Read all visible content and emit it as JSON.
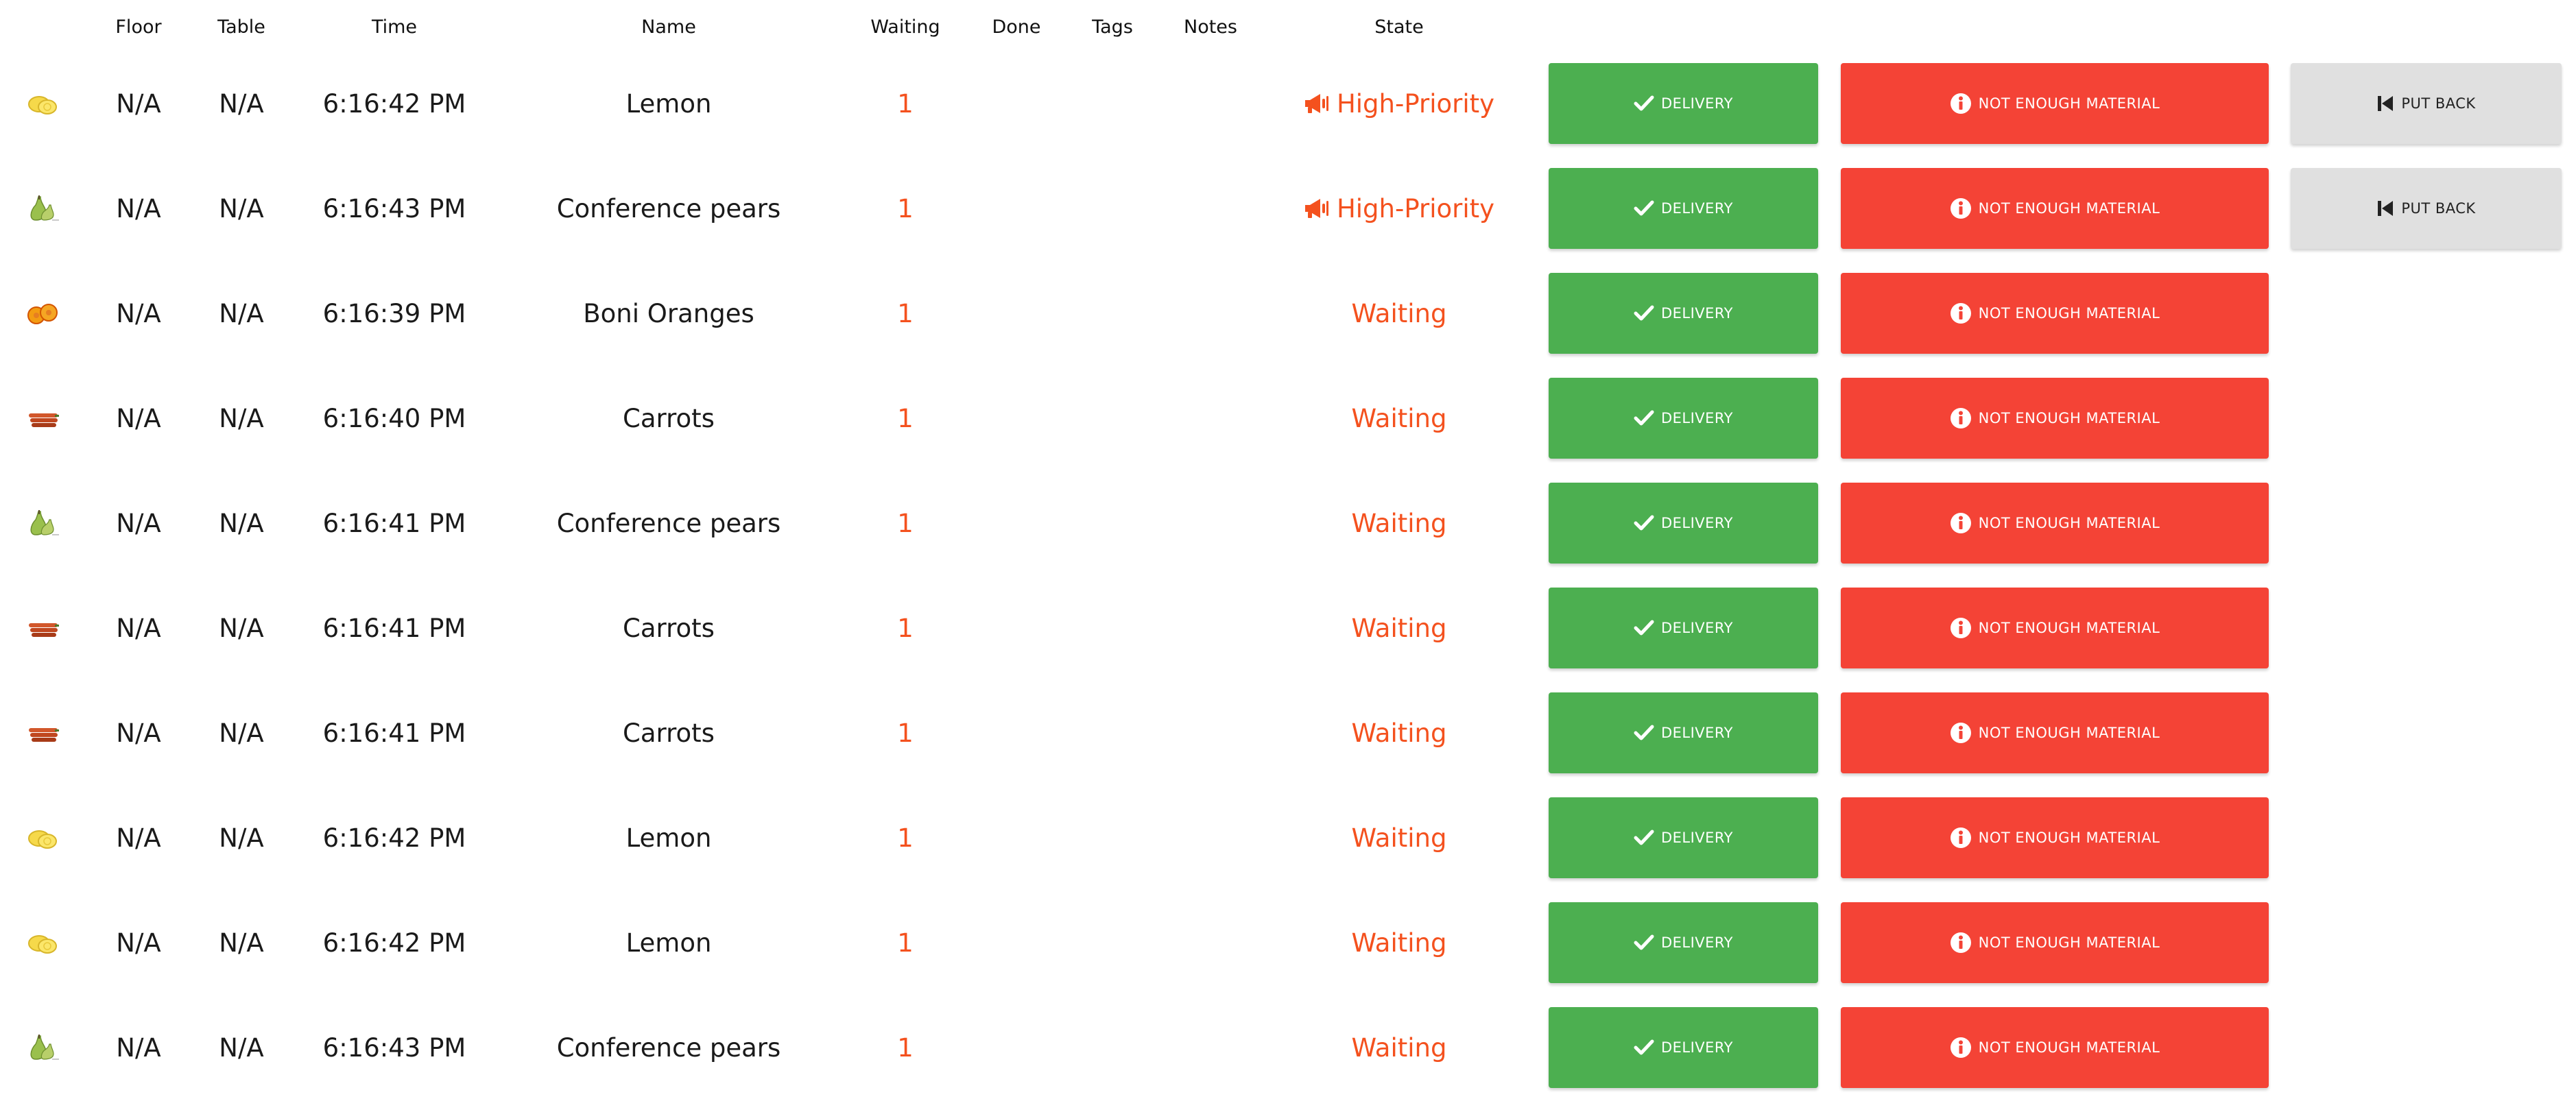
{
  "headers": {
    "floor": "Floor",
    "table": "Table",
    "time": "Time",
    "name": "Name",
    "waiting": "Waiting",
    "done": "Done",
    "tags": "Tags",
    "notes": "Notes",
    "state": "State"
  },
  "buttons": {
    "delivery": "DELIVERY",
    "not_enough": "NOT ENOUGH MATERIAL",
    "put_back": "PUT BACK"
  },
  "colors": {
    "delivery": "#4caf50",
    "not_enough": "#f44336",
    "put_back": "#e0e0e0",
    "accent": "#f4511e"
  },
  "rows": [
    {
      "icon": "lemon-icon",
      "floor": "N/A",
      "table": "N/A",
      "time": "6:16:42 PM",
      "name": "Lemon",
      "waiting": "1",
      "state": "High-Priority",
      "priority": true
    },
    {
      "icon": "pear-icon",
      "floor": "N/A",
      "table": "N/A",
      "time": "6:16:43 PM",
      "name": "Conference pears",
      "waiting": "1",
      "state": "High-Priority",
      "priority": true
    },
    {
      "icon": "orange-icon",
      "floor": "N/A",
      "table": "N/A",
      "time": "6:16:39 PM",
      "name": "Boni Oranges",
      "waiting": "1",
      "state": "Waiting",
      "priority": false
    },
    {
      "icon": "carrot-icon",
      "floor": "N/A",
      "table": "N/A",
      "time": "6:16:40 PM",
      "name": "Carrots",
      "waiting": "1",
      "state": "Waiting",
      "priority": false
    },
    {
      "icon": "pear-icon",
      "floor": "N/A",
      "table": "N/A",
      "time": "6:16:41 PM",
      "name": "Conference pears",
      "waiting": "1",
      "state": "Waiting",
      "priority": false
    },
    {
      "icon": "carrot-icon",
      "floor": "N/A",
      "table": "N/A",
      "time": "6:16:41 PM",
      "name": "Carrots",
      "waiting": "1",
      "state": "Waiting",
      "priority": false
    },
    {
      "icon": "carrot-icon",
      "floor": "N/A",
      "table": "N/A",
      "time": "6:16:41 PM",
      "name": "Carrots",
      "waiting": "1",
      "state": "Waiting",
      "priority": false
    },
    {
      "icon": "lemon-icon",
      "floor": "N/A",
      "table": "N/A",
      "time": "6:16:42 PM",
      "name": "Lemon",
      "waiting": "1",
      "state": "Waiting",
      "priority": false
    },
    {
      "icon": "lemon-icon",
      "floor": "N/A",
      "table": "N/A",
      "time": "6:16:42 PM",
      "name": "Lemon",
      "waiting": "1",
      "state": "Waiting",
      "priority": false
    },
    {
      "icon": "pear-icon",
      "floor": "N/A",
      "table": "N/A",
      "time": "6:16:43 PM",
      "name": "Conference pears",
      "waiting": "1",
      "state": "Waiting",
      "priority": false
    }
  ]
}
